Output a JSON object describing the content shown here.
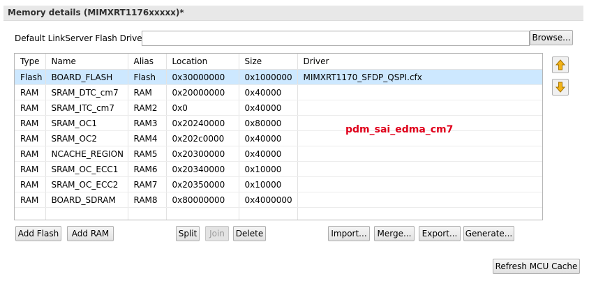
{
  "section": {
    "title": "Memory details (MIMXRT1176xxxxx)*"
  },
  "driver": {
    "label": "Default LinkServer Flash Driver",
    "value": "",
    "browse_label": "Browse..."
  },
  "table": {
    "columns": [
      "Type",
      "Name",
      "Alias",
      "Location",
      "Size",
      "Driver"
    ],
    "rows": [
      [
        "Flash",
        "BOARD_FLASH",
        "Flash",
        "0x30000000",
        "0x1000000",
        "MIMXRT1170_SFDP_QSPI.cfx"
      ],
      [
        "RAM",
        "SRAM_DTC_cm7",
        "RAM",
        "0x20000000",
        "0x40000",
        ""
      ],
      [
        "RAM",
        "SRAM_ITC_cm7",
        "RAM2",
        "0x0",
        "0x40000",
        ""
      ],
      [
        "RAM",
        "SRAM_OC1",
        "RAM3",
        "0x20240000",
        "0x80000",
        ""
      ],
      [
        "RAM",
        "SRAM_OC2",
        "RAM4",
        "0x202c0000",
        "0x40000",
        ""
      ],
      [
        "RAM",
        "NCACHE_REGION",
        "RAM5",
        "0x20300000",
        "0x40000",
        ""
      ],
      [
        "RAM",
        "SRAM_OC_ECC1",
        "RAM6",
        "0x20340000",
        "0x10000",
        ""
      ],
      [
        "RAM",
        "SRAM_OC_ECC2",
        "RAM7",
        "0x20350000",
        "0x10000",
        ""
      ],
      [
        "RAM",
        "BOARD_SDRAM",
        "RAM8",
        "0x80000000",
        "0x4000000",
        ""
      ]
    ],
    "selected_row": 0
  },
  "overlay_text": "pdm_sai_edma_cm7",
  "side_icons": {
    "up": "move-up-arrow-icon",
    "down": "move-down-arrow-icon"
  },
  "buttons": {
    "add_flash": "Add Flash",
    "add_ram": "Add RAM",
    "split": "Split",
    "join": "Join",
    "delete": "Delete",
    "import": "Import...",
    "merge": "Merge...",
    "export": "Export...",
    "generate": "Generate...",
    "refresh": "Refresh MCU Cache"
  },
  "colors": {
    "selection": "#cde8ff",
    "overlay": "#e0001b",
    "arrow": "#f2b318"
  }
}
